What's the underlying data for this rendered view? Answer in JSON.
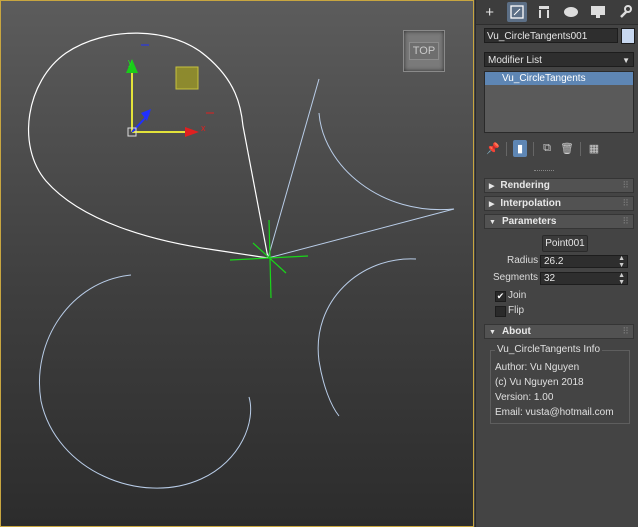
{
  "viewport": {
    "label": "TOP",
    "axis_x": "x",
    "axis_y": "y"
  },
  "panel": {
    "tabs": [
      {
        "icon": "plus-icon",
        "glyph": "+"
      },
      {
        "icon": "modify-icon",
        "glyph": "▣"
      },
      {
        "icon": "hierarchy-icon",
        "glyph": "⊓"
      },
      {
        "icon": "motion-icon",
        "glyph": "●"
      },
      {
        "icon": "display-icon",
        "glyph": "▬"
      },
      {
        "icon": "utilities-icon",
        "glyph": "🔧"
      }
    ],
    "object_name": "Vu_CircleTangents001",
    "object_color": "#c8d8f0",
    "modifier_list": "Modifier List",
    "stack_item": "Vu_CircleTangents",
    "rollouts": {
      "rendering": "Rendering",
      "interpolation": "Interpolation",
      "parameters": "Parameters",
      "about": "About"
    },
    "params": {
      "pick_button": "Point001",
      "radius_label": "Radius",
      "radius_value": "26.2",
      "segments_label": "Segments",
      "segments_value": "32",
      "join_label": "Join",
      "join_checked": true,
      "flip_label": "Flip",
      "flip_checked": false
    },
    "about_box": {
      "title": "Vu_CircleTangents Info",
      "author": "Author: Vu Nguyen",
      "copyright": "(c) Vu Nguyen 2018",
      "version": "Version: 1.00",
      "email": "Email: vusta@hotmail.com"
    }
  }
}
